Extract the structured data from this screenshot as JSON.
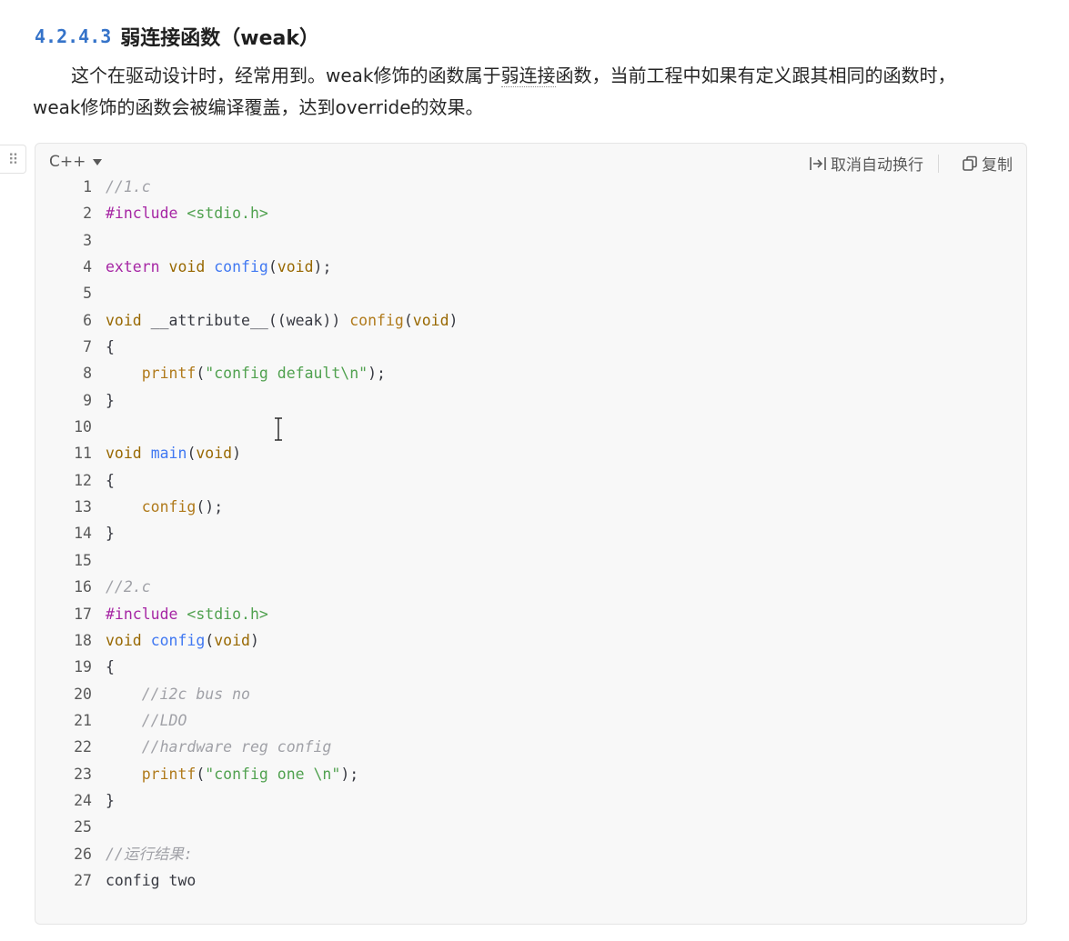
{
  "heading": {
    "number": "4.2.4.3",
    "title": "弱连接函数（weak）"
  },
  "paragraph": {
    "p1": "这个在驱动设计时，经常用到。weak修饰的函数属于",
    "p1_term": "弱连接",
    "p1_rest": "函数，当前工程中如果有定义跟其相同的函数时，",
    "p2": "weak修饰的函数会被编译覆盖，达到override的效果。"
  },
  "code_block": {
    "language": "C++",
    "wrap_label": "取消自动换行",
    "copy_label": "复制",
    "icons": {
      "drag": "drag-handle-icon",
      "wrap": "wrap-toggle-icon",
      "copy": "copy-icon",
      "caret": "chevron-down-icon"
    },
    "lines": [
      {
        "n": "1",
        "tokens": [
          {
            "t": "//1.c",
            "k": "cm"
          }
        ]
      },
      {
        "n": "2",
        "tokens": [
          {
            "t": "#include ",
            "k": "pre"
          },
          {
            "t": "<stdio.h>",
            "k": "str"
          }
        ]
      },
      {
        "n": "3",
        "tokens": []
      },
      {
        "n": "4",
        "tokens": [
          {
            "t": "extern",
            "k": "kw"
          },
          {
            "t": " ",
            "k": "p"
          },
          {
            "t": "void",
            "k": "ty"
          },
          {
            "t": " ",
            "k": "p"
          },
          {
            "t": "config",
            "k": "fn"
          },
          {
            "t": "(",
            "k": "p"
          },
          {
            "t": "void",
            "k": "ty"
          },
          {
            "t": ");",
            "k": "p"
          }
        ]
      },
      {
        "n": "5",
        "tokens": []
      },
      {
        "n": "6",
        "tokens": [
          {
            "t": "void",
            "k": "ty"
          },
          {
            "t": " __attribute__((weak)) ",
            "k": "p"
          },
          {
            "t": "config",
            "k": "fc"
          },
          {
            "t": "(",
            "k": "p"
          },
          {
            "t": "void",
            "k": "ty"
          },
          {
            "t": ")",
            "k": "p"
          }
        ]
      },
      {
        "n": "7",
        "tokens": [
          {
            "t": "{",
            "k": "p"
          }
        ]
      },
      {
        "n": "8",
        "tokens": [
          {
            "t": "    ",
            "k": "p"
          },
          {
            "t": "printf",
            "k": "fc"
          },
          {
            "t": "(",
            "k": "p"
          },
          {
            "t": "\"config default\\n\"",
            "k": "str"
          },
          {
            "t": ");",
            "k": "p"
          }
        ]
      },
      {
        "n": "9",
        "tokens": [
          {
            "t": "}",
            "k": "p"
          }
        ]
      },
      {
        "n": "10",
        "tokens": []
      },
      {
        "n": "11",
        "tokens": [
          {
            "t": "void",
            "k": "ty"
          },
          {
            "t": " ",
            "k": "p"
          },
          {
            "t": "main",
            "k": "fn"
          },
          {
            "t": "(",
            "k": "p"
          },
          {
            "t": "void",
            "k": "ty"
          },
          {
            "t": ")",
            "k": "p"
          }
        ]
      },
      {
        "n": "12",
        "tokens": [
          {
            "t": "{",
            "k": "p"
          }
        ]
      },
      {
        "n": "13",
        "tokens": [
          {
            "t": "    ",
            "k": "p"
          },
          {
            "t": "config",
            "k": "fc"
          },
          {
            "t": "();",
            "k": "p"
          }
        ]
      },
      {
        "n": "14",
        "tokens": [
          {
            "t": "}",
            "k": "p"
          }
        ]
      },
      {
        "n": "15",
        "tokens": []
      },
      {
        "n": "16",
        "tokens": [
          {
            "t": "//2.c",
            "k": "cm"
          }
        ]
      },
      {
        "n": "17",
        "tokens": [
          {
            "t": "#include ",
            "k": "pre"
          },
          {
            "t": "<stdio.h>",
            "k": "str"
          }
        ]
      },
      {
        "n": "18",
        "tokens": [
          {
            "t": "void",
            "k": "ty"
          },
          {
            "t": " ",
            "k": "p"
          },
          {
            "t": "config",
            "k": "fn"
          },
          {
            "t": "(",
            "k": "p"
          },
          {
            "t": "void",
            "k": "ty"
          },
          {
            "t": ")",
            "k": "p"
          }
        ]
      },
      {
        "n": "19",
        "tokens": [
          {
            "t": "{",
            "k": "p"
          }
        ]
      },
      {
        "n": "20",
        "tokens": [
          {
            "t": "    ",
            "k": "p"
          },
          {
            "t": "//i2c bus no",
            "k": "cm"
          }
        ]
      },
      {
        "n": "21",
        "tokens": [
          {
            "t": "    ",
            "k": "p"
          },
          {
            "t": "//LDO",
            "k": "cm"
          }
        ]
      },
      {
        "n": "22",
        "tokens": [
          {
            "t": "    ",
            "k": "p"
          },
          {
            "t": "//hardware reg config",
            "k": "cm"
          }
        ]
      },
      {
        "n": "23",
        "tokens": [
          {
            "t": "    ",
            "k": "p"
          },
          {
            "t": "printf",
            "k": "fc"
          },
          {
            "t": "(",
            "k": "p"
          },
          {
            "t": "\"config one \\n\"",
            "k": "str"
          },
          {
            "t": ");",
            "k": "p"
          }
        ]
      },
      {
        "n": "24",
        "tokens": [
          {
            "t": "}",
            "k": "p"
          }
        ]
      },
      {
        "n": "25",
        "tokens": []
      },
      {
        "n": "26",
        "tokens": [
          {
            "t": "//运行结果:",
            "k": "cm"
          }
        ]
      },
      {
        "n": "27",
        "tokens": [
          {
            "t": "config two",
            "k": "p"
          }
        ]
      }
    ]
  },
  "colors": {
    "heading_number": "#3573c9",
    "comment": "#a0a1a7",
    "preprocessor": "#a626a4",
    "string": "#50a14f",
    "type": "#986801",
    "function": "#4078f2",
    "call": "#b07a1b",
    "code_bg": "#f8f8f8"
  }
}
